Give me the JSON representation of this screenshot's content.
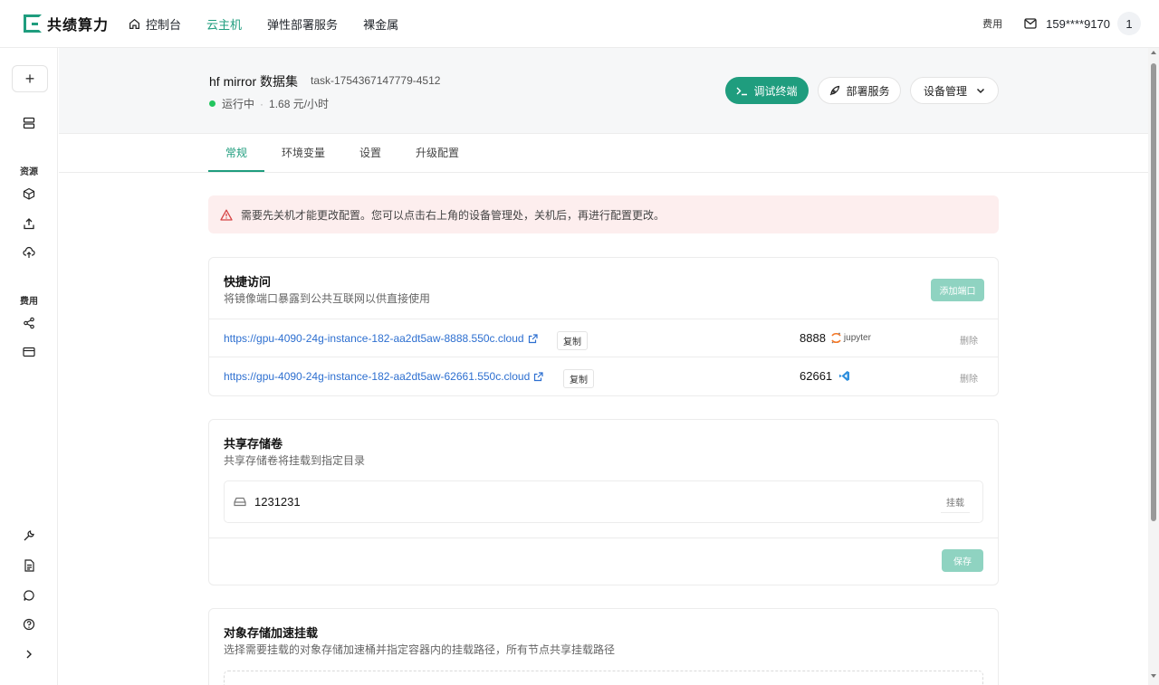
{
  "brand": {
    "name": "共绩算力",
    "color": "#1f9d7e"
  },
  "topnav": {
    "items": [
      {
        "label": "控制台",
        "icon": "home-icon"
      },
      {
        "label": "云主机",
        "active": true
      },
      {
        "label": "弹性部署服务"
      },
      {
        "label": "裸金属"
      }
    ],
    "fee": "费用",
    "phone": "159****9170",
    "avatar": "1"
  },
  "sidebar": {
    "plus": "+",
    "resources_label": "资源",
    "fees_label": "费用"
  },
  "instance": {
    "name": "hf mirror 数据集",
    "task_id": "task-1754367147779-4512",
    "status": "运行中",
    "separator": "·",
    "price": "1.68 元/小时"
  },
  "actions": {
    "terminal": "调试终端",
    "deploy": "部署服务",
    "device": "设备管理"
  },
  "tabs": [
    "常规",
    "环境变量",
    "设置",
    "升级配置"
  ],
  "alert": "需要先关机才能更改配置。您可以点击右上角的设备管理处，关机后，再进行配置更改。",
  "quick_access": {
    "title": "快捷访问",
    "subtitle": "将镜像端口暴露到公共互联网以供直接使用",
    "add_port": "添加端口",
    "copy": "复制",
    "delete": "删除",
    "ports": [
      {
        "url": "https://gpu-4090-24g-instance-182-aa2dt5aw-8888.550c.cloud",
        "port": "8888",
        "app": "jupyter",
        "app_icon": "jupyter-icon"
      },
      {
        "url": "https://gpu-4090-24g-instance-182-aa2dt5aw-62661.550c.cloud",
        "port": "62661",
        "app": "",
        "app_icon": "vscode-icon"
      }
    ]
  },
  "shared_storage": {
    "title": "共享存储卷",
    "subtitle": "共享存储卷将挂载到指定目录",
    "volume": "1231231",
    "mount": "挂载",
    "save": "保存"
  },
  "object_storage": {
    "title": "对象存储加速挂载",
    "subtitle": "选择需要挂载的对象存储加速桶并指定容器内的挂载路径，所有节点共享挂载路径"
  }
}
